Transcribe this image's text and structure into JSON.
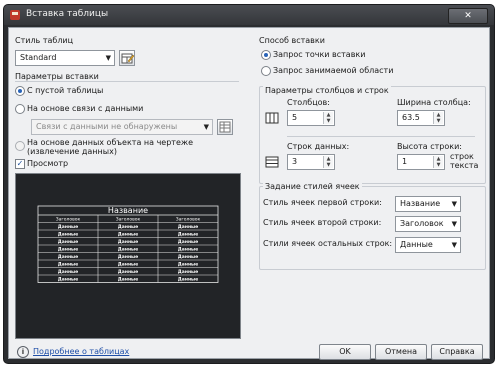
{
  "window": {
    "title": "Вставка таблицы",
    "close_glyph": "✕"
  },
  "table_style": {
    "label": "Стиль таблиц",
    "value": "Standard"
  },
  "insert_options": {
    "label": "Параметры вставки",
    "from_empty": "С пустой таблицы",
    "from_data_link": "На основе связи с данными",
    "data_link_value": "Связи с данными не обнаружены",
    "from_object_data": "На основе данных объекта на чертеже (извлечение данных)"
  },
  "preview": {
    "checkbox_label": "Просмотр",
    "title_row": "Название",
    "headers": [
      "Заголовок",
      "Заголовок",
      "Заголовок"
    ],
    "data_cell": "Данные",
    "data_rows": 8
  },
  "insertion_behavior": {
    "label": "Способ вставки",
    "specify_point": "Запрос точки вставки",
    "specify_window": "Запрос занимаемой области"
  },
  "col_row": {
    "label": "Параметры столбцов и строк",
    "columns_label": "Столбцов:",
    "columns_value": "5",
    "col_width_label": "Ширина столбца:",
    "col_width_value": "63.5",
    "data_rows_label": "Строк данных:",
    "data_rows_value": "3",
    "row_height_label": "Высота строки:",
    "row_height_value": "1",
    "row_height_units": "строк текста"
  },
  "cell_styles": {
    "label": "Задание стилей ячеек",
    "first_row_label": "Стиль ячеек первой строки:",
    "first_row_value": "Название",
    "second_row_label": "Стиль ячеек второй строки:",
    "second_row_value": "Заголовок",
    "other_rows_label": "Стили ячеек остальных строк:",
    "other_rows_value": "Данные"
  },
  "footer": {
    "learn_link": "Подробнее о таблицах",
    "ok": "OK",
    "cancel": "Отмена",
    "help": "Справка"
  }
}
